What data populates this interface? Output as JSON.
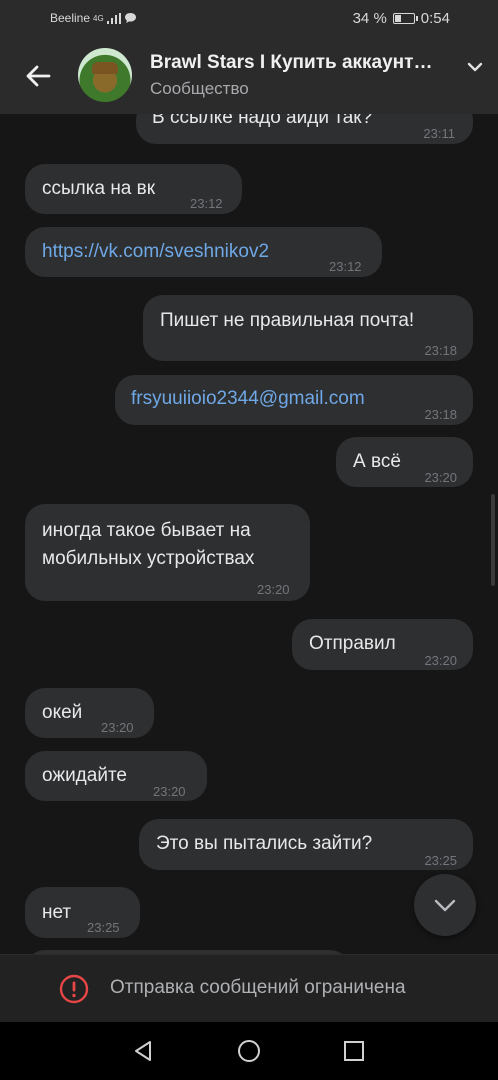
{
  "status_bar": {
    "carrier": "Beeline",
    "network": "4G",
    "battery": "34 %",
    "time": "0:54"
  },
  "header": {
    "title": "Brawl Stars I Купить аккаунт…",
    "subtitle": "Сообщество",
    "icons": [
      "back-arrow-icon",
      "chevron-down-icon"
    ]
  },
  "messages": [
    {
      "side": "out",
      "text": "В ссылке надо аиди так?",
      "time": "23:11"
    },
    {
      "side": "in",
      "text": "ссылка на вк",
      "time": "23:12"
    },
    {
      "side": "in",
      "text": "https://vk.com/sveshnikov2",
      "time": "23:12",
      "link": true
    },
    {
      "side": "out",
      "text": "Пишет не правильная почта!",
      "time": "23:18"
    },
    {
      "side": "out",
      "text": "frsyuuiioio2344@gmail.com",
      "time": "23:18",
      "link": true
    },
    {
      "side": "out",
      "text": "А всё",
      "time": "23:20"
    },
    {
      "side": "in",
      "text_line1": "иногда такое бывает на",
      "text_line2": "мобильных устройствах",
      "time": "23:20"
    },
    {
      "side": "out",
      "text": "Отправил",
      "time": "23:20"
    },
    {
      "side": "in",
      "text": "окей",
      "time": "23:20"
    },
    {
      "side": "in",
      "text": "ожидайте",
      "time": "23:20"
    },
    {
      "side": "out",
      "text": "Это вы пытались зайти?",
      "time": "23:25"
    },
    {
      "side": "in",
      "text": "нет",
      "time": "23:25"
    }
  ],
  "footer": {
    "restricted_text": "Отправка сообщений ограничена",
    "icon": "warning-circle-icon"
  },
  "nav": {
    "icons": [
      "back-triangle-icon",
      "home-circle-icon",
      "recents-square-icon"
    ]
  },
  "colors": {
    "background": "#161616",
    "bubble": "#2e2f31",
    "link": "#6fa8e6",
    "warning": "#e64646"
  }
}
